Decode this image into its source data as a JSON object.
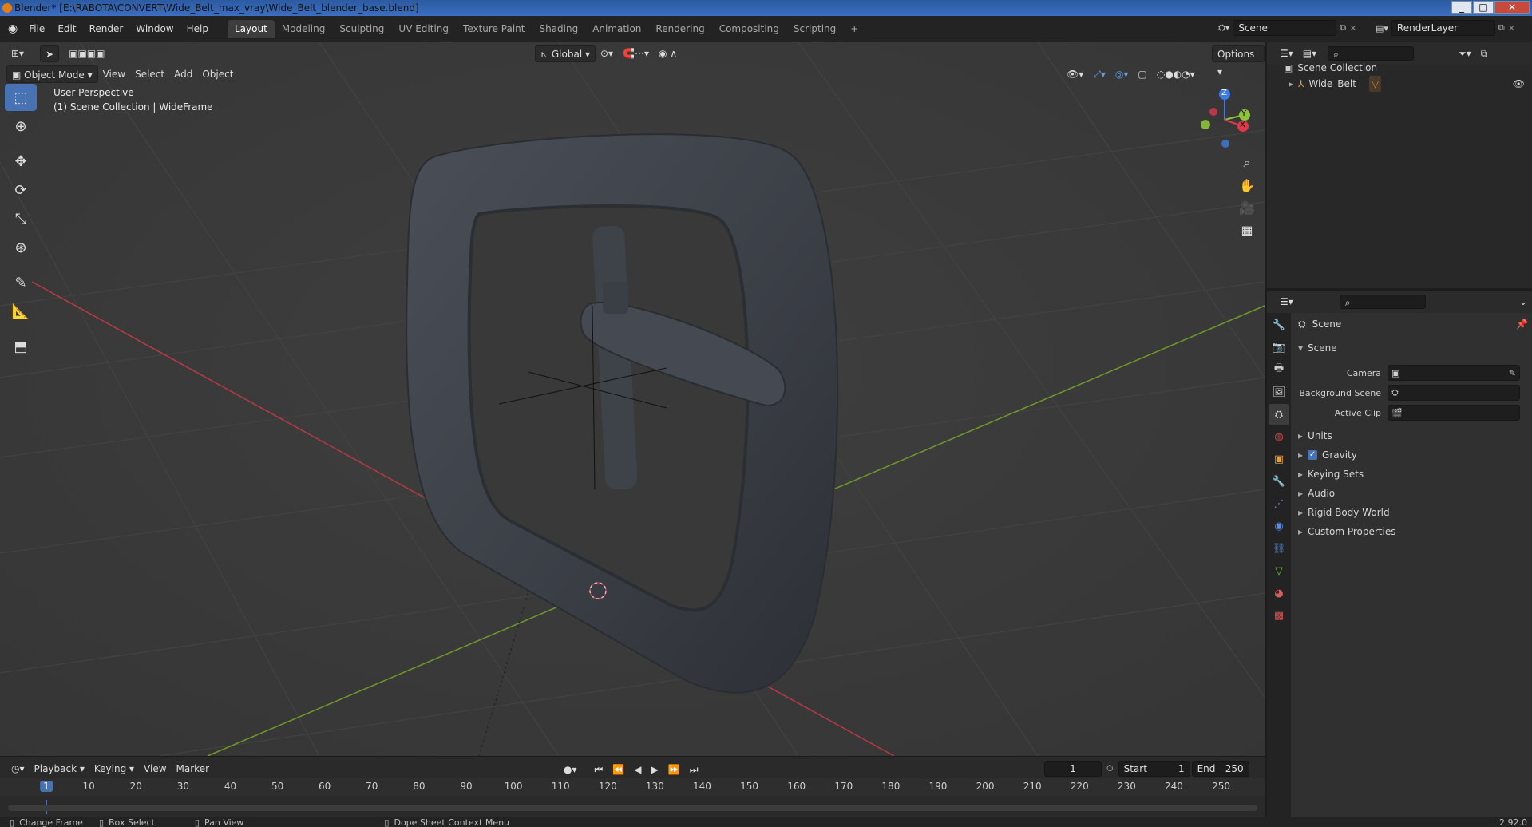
{
  "window": {
    "title": "Blender* [E:\\RABOTA\\CONVERT\\Wide_Belt_max_vray\\Wide_Belt_blender_base.blend]",
    "controls": [
      "_",
      "□",
      "✕"
    ]
  },
  "menubar": {
    "items": [
      "File",
      "Edit",
      "Render",
      "Window",
      "Help"
    ],
    "workspaces": [
      "Layout",
      "Modeling",
      "Sculpting",
      "UV Editing",
      "Texture Paint",
      "Shading",
      "Animation",
      "Rendering",
      "Compositing",
      "Scripting"
    ],
    "add_tab": "+",
    "scene_name": "Scene",
    "render_layer": "RenderLayer"
  },
  "viewport": {
    "orientation": "Global",
    "options_label": "Options",
    "mode": "Object Mode",
    "menus": [
      "View",
      "Select",
      "Add",
      "Object"
    ],
    "overlay_title": "User Perspective",
    "overlay_sub": "(1) Scene Collection | WideFrame",
    "gizmo": {
      "z": "Z",
      "y": "Y",
      "x": "X"
    },
    "colors": {
      "bg": "#393939",
      "x_axis": "#b83a43",
      "y_axis": "#6f9a2a",
      "accent": "#4772b3"
    }
  },
  "outliner": {
    "root": "Scene Collection",
    "items": [
      {
        "label": "Wide_Belt"
      }
    ]
  },
  "properties": {
    "header": "Scene",
    "section": "Scene",
    "fields": [
      {
        "label": "Camera",
        "value": ""
      },
      {
        "label": "Background Scene",
        "value": ""
      },
      {
        "label": "Active Clip",
        "value": ""
      }
    ],
    "subsections": [
      "Units",
      "Gravity",
      "Keying Sets",
      "Audio",
      "Rigid Body World",
      "Custom Properties"
    ],
    "gravity_checked": true
  },
  "timeline": {
    "menus": [
      "Playback",
      "Keying",
      "View",
      "Marker"
    ],
    "current_frame": "1",
    "start_label": "Start",
    "start_value": "1",
    "end_label": "End",
    "end_value": "250",
    "ticks": [
      "1",
      "10",
      "20",
      "30",
      "40",
      "50",
      "60",
      "70",
      "80",
      "90",
      "100",
      "110",
      "120",
      "130",
      "140",
      "150",
      "160",
      "170",
      "180",
      "190",
      "200",
      "210",
      "220",
      "230",
      "240",
      "250"
    ]
  },
  "statusbar": {
    "items": [
      "Change Frame",
      "Box Select",
      "Pan View",
      "Dope Sheet Context Menu"
    ],
    "version": "2.92.0"
  }
}
